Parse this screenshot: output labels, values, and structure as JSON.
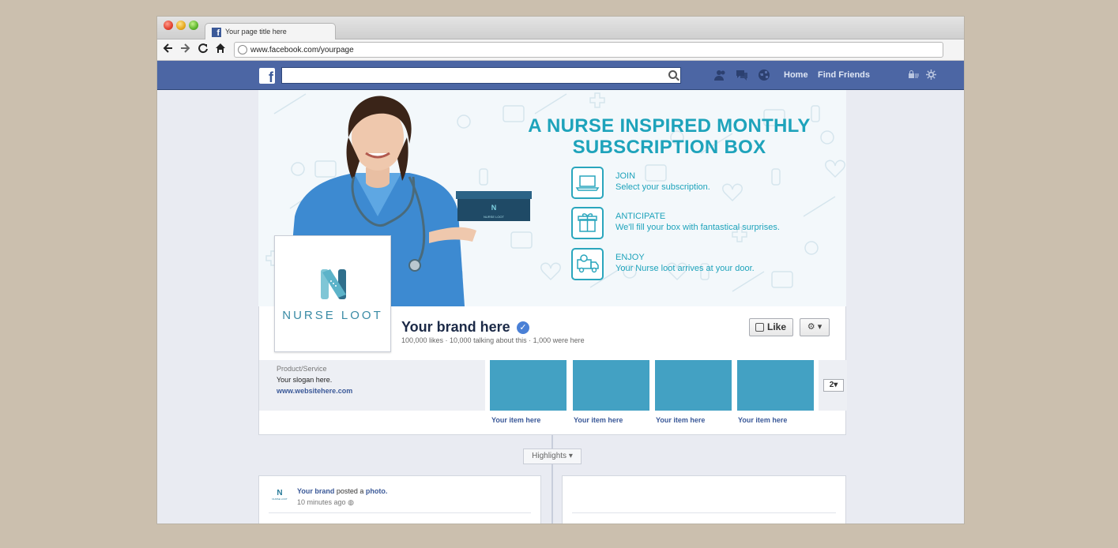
{
  "browser": {
    "tab_title": "Your page title here",
    "url": "www.facebook.com/yourpage",
    "back_icon": "arrow-left-icon",
    "forward_icon": "arrow-right-icon",
    "reload_icon": "reload-icon",
    "home_icon": "home-icon"
  },
  "fb_header": {
    "logo": "f",
    "nav_home": "Home",
    "nav_find_friends": "Find Friends",
    "colors": {
      "bar": "#4c66a4"
    }
  },
  "cover": {
    "headline_line1": "A NURSE INSPIRED MONTHLY",
    "headline_line2": "SUBSCRIPTION BOX",
    "steps": [
      {
        "title": "JOIN",
        "desc": "Select your subscription.",
        "icon": "laptop-icon"
      },
      {
        "title": "ANTICIPATE",
        "desc": "We'll fill your box with fantastical surprises.",
        "icon": "gift-icon"
      },
      {
        "title": "ENJOY",
        "desc": "Your Nurse loot arrives at your door.",
        "icon": "delivery-truck-icon"
      }
    ],
    "box_label": "NURSE LOOT",
    "accent_color": "#1ea3bb"
  },
  "profile": {
    "logo_letter": "N",
    "logo_text": "NURSE LOOT"
  },
  "page_info": {
    "name": "Your brand here",
    "stats": "100,000 likes · 10,000 talking about this · 1,000 were here",
    "like_label": "Like",
    "category": "Product/Service",
    "slogan": "Your slogan here.",
    "website": "www.websitehere.com",
    "more_count": "2"
  },
  "apps": [
    {
      "label": "Your item here"
    },
    {
      "label": "Your item here"
    },
    {
      "label": "Your item here"
    },
    {
      "label": "Your item here"
    }
  ],
  "timeline": {
    "highlights_label": "Highlights",
    "post": {
      "avatar_letter": "N",
      "avatar_text": "NURSE LOOT",
      "author": "Your brand",
      "action_before": "posted a",
      "action_link": "photo.",
      "time": "10 minutes ago"
    }
  }
}
